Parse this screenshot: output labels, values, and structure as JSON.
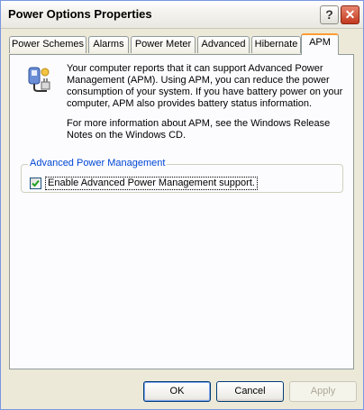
{
  "window": {
    "title": "Power Options Properties"
  },
  "titlebar": {
    "help_label": "?",
    "close_label": "✕"
  },
  "tabs": [
    {
      "label": "Power Schemes"
    },
    {
      "label": "Alarms"
    },
    {
      "label": "Power Meter"
    },
    {
      "label": "Advanced"
    },
    {
      "label": "Hibernate"
    },
    {
      "label": "APM",
      "active": true
    }
  ],
  "info": {
    "paragraph1": "Your computer reports that it can support Advanced Power Management (APM).  Using APM, you can reduce the power consumption of your system.  If you have battery power on your computer, APM also provides battery status information.",
    "paragraph2": "For more information about APM, see the Windows Release Notes on the Windows CD."
  },
  "group": {
    "title": "Advanced Power Management",
    "checkbox_label": "Enable Advanced Power Management support.",
    "checked": true
  },
  "buttons": {
    "ok": "OK",
    "cancel": "Cancel",
    "apply": "Apply"
  },
  "icons": {
    "power_plug": "power-plug-icon",
    "check": "checkmark-icon"
  },
  "colors": {
    "accent_tab": "#ff9c30",
    "group_title": "#0046d5",
    "check_mark": "#21a121"
  }
}
